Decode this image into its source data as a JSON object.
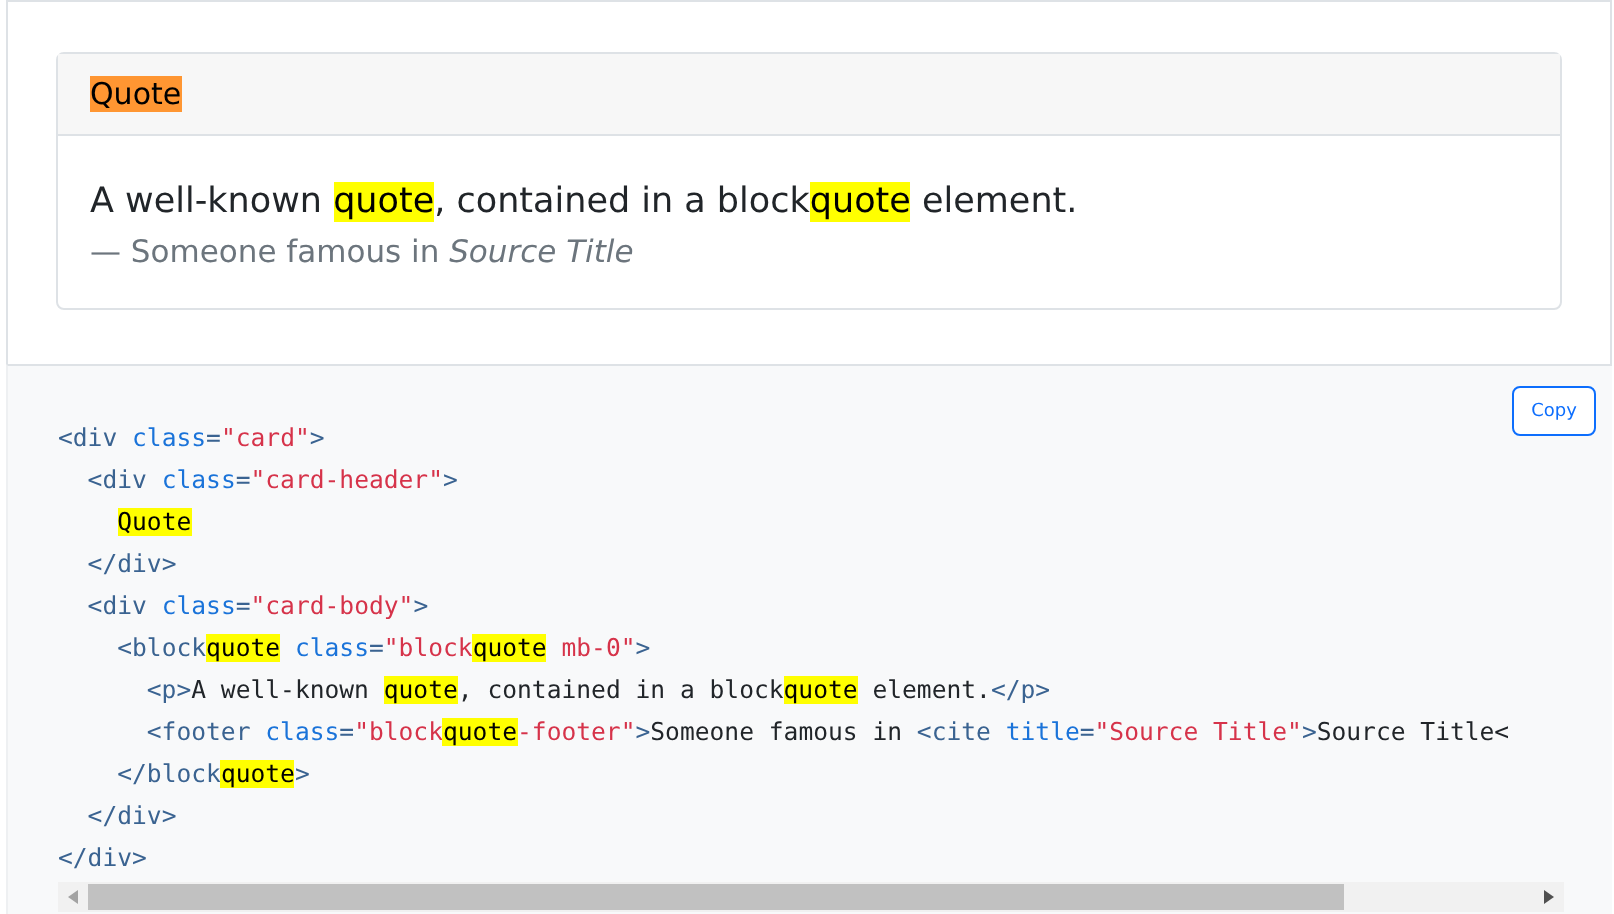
{
  "preview": {
    "card_header": [
      {
        "text": "Quote",
        "match": true,
        "current": true
      }
    ],
    "quote_text": [
      {
        "text": "A well-known ",
        "match": false
      },
      {
        "text": "quote",
        "match": true,
        "current": false
      },
      {
        "text": ", contained in a block",
        "match": false
      },
      {
        "text": "quote",
        "match": true,
        "current": false
      },
      {
        "text": " element.",
        "match": false
      }
    ],
    "footer": "— Someone famous in *Source Title*"
  },
  "code": {
    "copy_button": "Copy",
    "lines": [
      {
        "tokens": [
          {
            "kind": "tag",
            "text": "<div",
            "match": false
          },
          {
            "kind": "attr",
            "text": " class",
            "match": false
          },
          {
            "kind": "tag",
            "text": "=",
            "match": false
          },
          {
            "kind": "string",
            "text": "\"card\"",
            "match": false
          },
          {
            "kind": "tag",
            "text": ">",
            "match": false
          }
        ],
        "children": [
          {
            "tokens": [
              {
                "kind": "tag",
                "text": "<div",
                "match": false
              },
              {
                "kind": "attr",
                "text": " class",
                "match": false
              },
              {
                "kind": "tag",
                "text": "=",
                "match": false
              },
              {
                "kind": "string",
                "text": "\"card-header\"",
                "match": false
              },
              {
                "kind": "tag",
                "text": ">",
                "match": false
              }
            ],
            "children": [
              {
                "tokens": [
                  {
                    "kind": "text",
                    "text": "Quote",
                    "match": true
                  }
                ]
              }
            ]
          },
          {
            "tokens": [
              {
                "kind": "tag",
                "text": "</div>",
                "match": false
              }
            ]
          },
          {
            "tokens": [
              {
                "kind": "tag",
                "text": "<div",
                "match": false
              },
              {
                "kind": "attr",
                "text": " class",
                "match": false
              },
              {
                "kind": "tag",
                "text": "=",
                "match": false
              },
              {
                "kind": "string",
                "text": "\"card-body\"",
                "match": false
              },
              {
                "kind": "tag",
                "text": ">",
                "match": false
              }
            ],
            "children": [
              {
                "tokens": [
                  {
                    "kind": "tag",
                    "text": "<block",
                    "match": false
                  },
                  {
                    "kind": "tag",
                    "text": "quote",
                    "match": true
                  },
                  {
                    "kind": "attr",
                    "text": " class",
                    "match": false
                  },
                  {
                    "kind": "tag",
                    "text": "=",
                    "match": false
                  },
                  {
                    "kind": "string",
                    "text": "\"block",
                    "match": false
                  },
                  {
                    "kind": "string",
                    "text": "quote",
                    "match": true
                  },
                  {
                    "kind": "string",
                    "text": " mb-0\"",
                    "match": false
                  },
                  {
                    "kind": "tag",
                    "text": ">",
                    "match": false
                  }
                ],
                "children": [
                  {
                    "tokens": [
                      {
                        "kind": "tag",
                        "text": "<p>",
                        "match": false
                      },
                      {
                        "kind": "text",
                        "text": "A well-known ",
                        "match": false
                      },
                      {
                        "kind": "text",
                        "text": "quote",
                        "match": true
                      },
                      {
                        "kind": "text",
                        "text": ", contained in a block",
                        "match": false
                      },
                      {
                        "kind": "text",
                        "text": "quote",
                        "match": true
                      },
                      {
                        "kind": "text",
                        "text": " element.",
                        "match": false
                      },
                      {
                        "kind": "tag",
                        "text": "</p>",
                        "match": false
                      }
                    ]
                  },
                  {
                    "tokens": [
                      {
                        "kind": "tag",
                        "text": "<footer",
                        "match": false
                      },
                      {
                        "kind": "attr",
                        "text": " class",
                        "match": false
                      },
                      {
                        "kind": "tag",
                        "text": "=",
                        "match": false
                      },
                      {
                        "kind": "string",
                        "text": "\"block",
                        "match": false
                      },
                      {
                        "kind": "string",
                        "text": "quote",
                        "match": true
                      },
                      {
                        "kind": "string",
                        "text": "-footer\"",
                        "match": false
                      },
                      {
                        "kind": "tag",
                        "text": ">",
                        "match": false
                      },
                      {
                        "kind": "text",
                        "text": "Someone famous in ",
                        "match": false
                      },
                      {
                        "kind": "tag",
                        "text": "<cite",
                        "match": false
                      },
                      {
                        "kind": "attr",
                        "text": " title",
                        "match": false
                      },
                      {
                        "kind": "tag",
                        "text": "=",
                        "match": false
                      },
                      {
                        "kind": "string",
                        "text": "\"Source Title\"",
                        "match": false
                      },
                      {
                        "kind": "tag",
                        "text": ">",
                        "match": false
                      },
                      {
                        "kind": "text",
                        "text": "Source Title<",
                        "match": false
                      }
                    ]
                  }
                ]
              },
              {
                "tokens": [
                  {
                    "kind": "tag",
                    "text": "</block",
                    "match": false
                  },
                  {
                    "kind": "tag",
                    "text": "quote",
                    "match": true
                  },
                  {
                    "kind": "tag",
                    "text": ">",
                    "match": false
                  }
                ]
              }
            ]
          },
          {
            "tokens": [
              {
                "kind": "tag",
                "text": "</div>",
                "match": false
              }
            ]
          }
        ]
      },
      {
        "tokens": [
          {
            "kind": "tag",
            "text": "</div>",
            "match": false
          }
        ]
      }
    ]
  }
}
